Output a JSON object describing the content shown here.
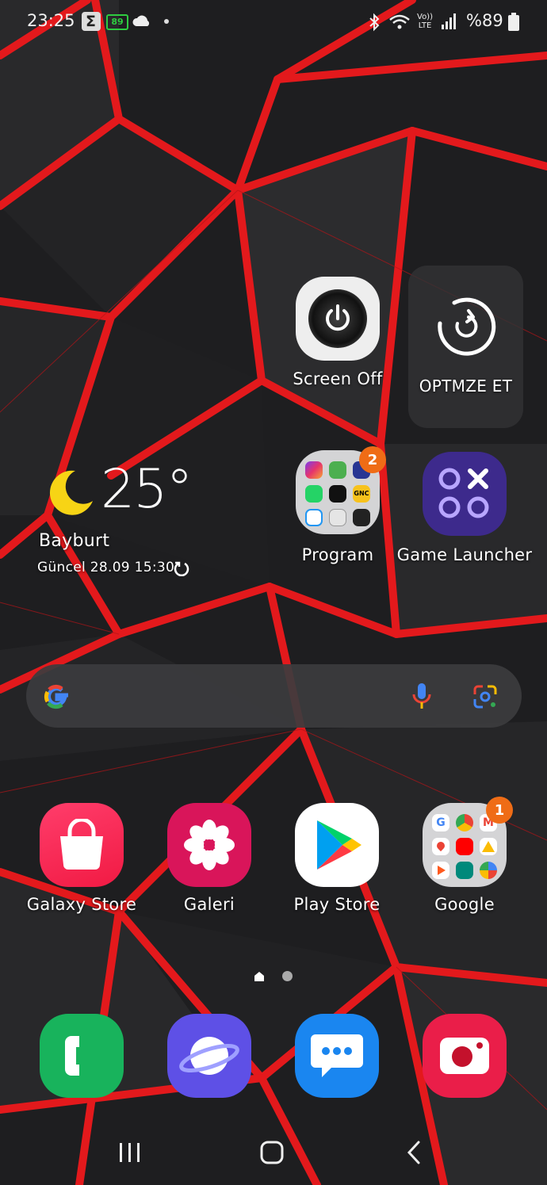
{
  "status_bar": {
    "time": "23:25",
    "battery_small": "89",
    "battery_percent": "%89",
    "volte": "Vo)) LTE"
  },
  "widgets": {
    "screen_off_label": "Screen Off",
    "optimize_label": "OPTMZE ET",
    "weather": {
      "temperature": "25°",
      "city": "Bayburt",
      "updated": "Güncel 28.09 15:30"
    }
  },
  "apps_row1": {
    "program": {
      "label": "Program",
      "badge": "2"
    },
    "game_launcher": {
      "label": "Game Launcher"
    }
  },
  "apps_row2": [
    {
      "label": "Galaxy Store"
    },
    {
      "label": "Galeri"
    },
    {
      "label": "Play Store"
    },
    {
      "label": "Google",
      "badge": "1"
    }
  ],
  "mini_labels": {
    "gnc": "GNC"
  },
  "colors": {
    "accent_red": "#e0161b",
    "badge_orange": "#ef6c16"
  }
}
